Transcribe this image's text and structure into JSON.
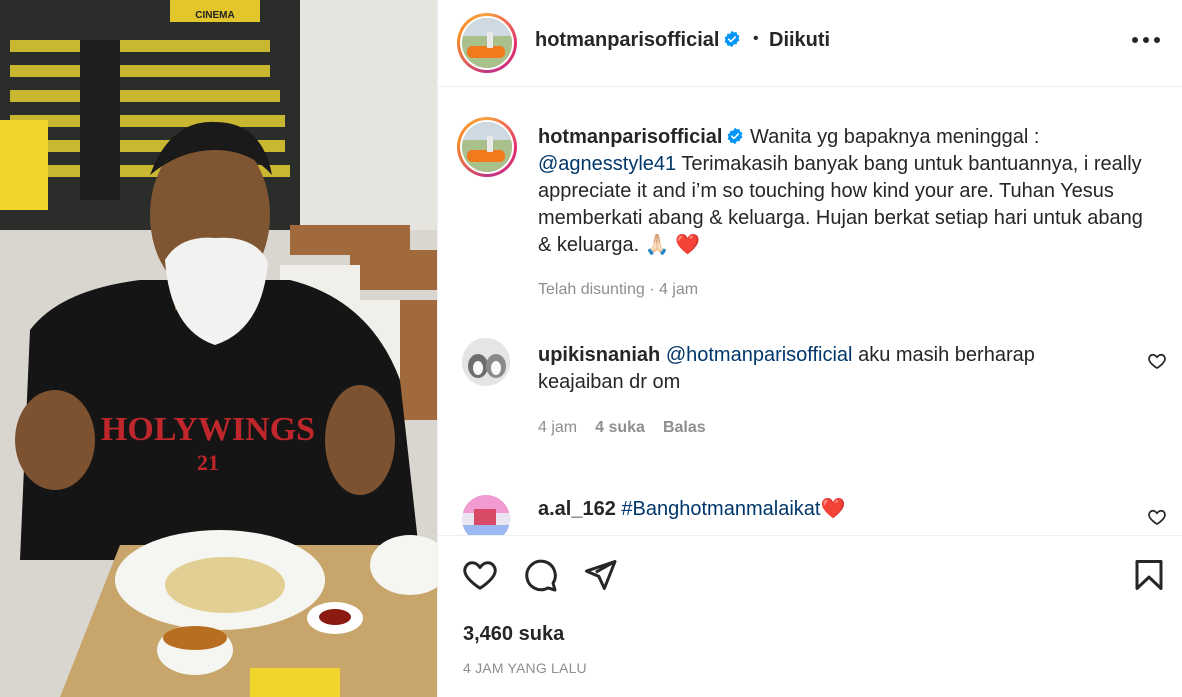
{
  "post": {
    "username": "hotmanparisofficial",
    "follow_status": "Diikuti",
    "separator": "•",
    "more_icon": "more-horizontal-icon"
  },
  "caption": {
    "username": "hotmanparisofficial",
    "text_1": "Wanita yg bapaknya meninggal :",
    "mention": "@agnesstyle41",
    "text_2": "Terimakasih banyak bang untuk bantuannya, i really appreciate it and i’m so touching how kind your are. Tuhan Yesus memberkati abang & keluarga. Hujan berkat setiap hari untuk abang & keluarga.",
    "emoji_1": "🙏🏻",
    "emoji_2": "❤️",
    "meta": "Telah disunting · 4 jam"
  },
  "comments": [
    {
      "username": "upikisnaniah",
      "mention": "@hotmanparisofficial",
      "text": "aku masih berharap keajaiban dr om",
      "time": "4 jam",
      "likes": "4 suka",
      "reply": "Balas"
    },
    {
      "username": "a.al_162",
      "hashtag": "#Banghotmanmalaikat",
      "emoji": "❤️"
    }
  ],
  "actions": {
    "like_icon": "heart-icon",
    "comment_icon": "comment-icon",
    "share_icon": "paper-plane-icon",
    "save_icon": "bookmark-icon",
    "likes_count": "3,460 suka",
    "timestamp": "4 JAM YANG LALU"
  },
  "media": {
    "shirt_text": "HOLYWINGS",
    "shirt_number": "21",
    "sign_text": "CINEMA"
  },
  "colors": {
    "link": "#00376b",
    "muted": "#8e8e8e",
    "verified": "#0095f6",
    "heart": "#ed4956"
  }
}
